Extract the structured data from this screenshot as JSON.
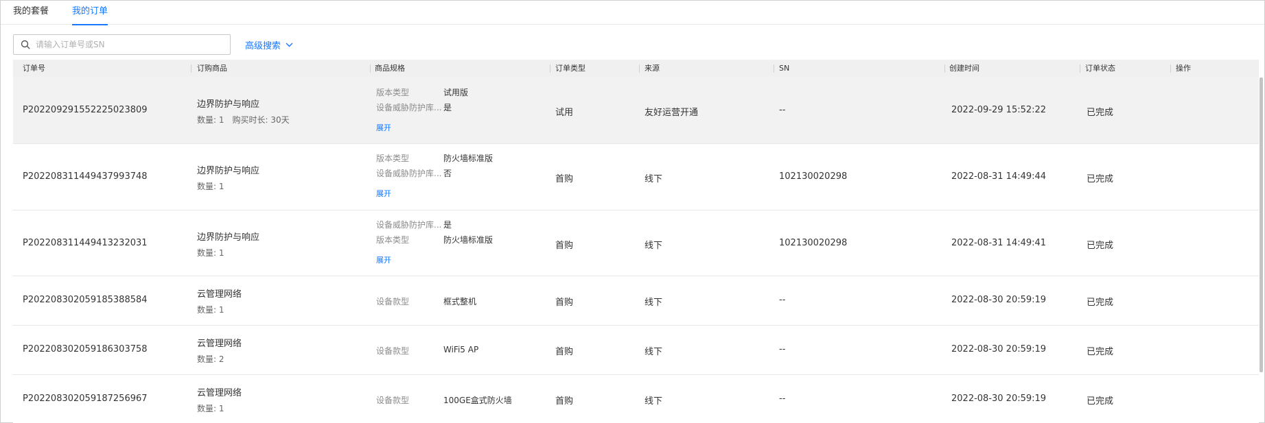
{
  "tabs": [
    {
      "label": "我的套餐"
    },
    {
      "label": "我的订单"
    }
  ],
  "search": {
    "placeholder": "请输入订单号或SN",
    "value": ""
  },
  "advanced_search": {
    "label": "高级搜索"
  },
  "columns": [
    "订单号",
    "订购商品",
    "商品规格",
    "订单类型",
    "来源",
    "SN",
    "创建时间",
    "订单状态",
    "操作"
  ],
  "orders": [
    {
      "order_no": "P20220929155222502380​9",
      "product": "边界防护与响应",
      "qty_text": "数量: 1",
      "duration_text": "购买时长: 30天",
      "specs": [
        {
          "label": "版本类型",
          "value": "试用版"
        },
        {
          "label": "设备威胁防护库...",
          "value": "是"
        }
      ],
      "expand": "展开",
      "type": "试用",
      "source": "友好运营开通",
      "sn": "--",
      "created": "2022-09-29 15:52:22",
      "status": "已完成"
    },
    {
      "order_no": "P20220831144943799374​8",
      "product": "边界防护与响应",
      "qty_text": "数量: 1",
      "specs": [
        {
          "label": "版本类型",
          "value": "防火墙标准版"
        },
        {
          "label": "设备威胁防护库...",
          "value": "否"
        }
      ],
      "expand": "展开",
      "type": "首购",
      "source": "线下",
      "sn": "102130020298",
      "created": "2022-08-31 14:49:44",
      "status": "已完成"
    },
    {
      "order_no": "P20220831144941323203​1",
      "product": "边界防护与响应",
      "qty_text": "数量: 1",
      "specs": [
        {
          "label": "设备威胁防护库...",
          "value": "是"
        },
        {
          "label": "版本类型",
          "value": "防火墙标准版"
        }
      ],
      "expand": "展开",
      "type": "首购",
      "source": "线下",
      "sn": "102130020298",
      "created": "2022-08-31 14:49:41",
      "status": "已完成"
    },
    {
      "order_no": "P20220830205918538858​4",
      "product": "云管理网络",
      "qty_text": "数量: 1",
      "specs": [
        {
          "label": "设备款型",
          "value": "框式整机"
        }
      ],
      "type": "首购",
      "source": "线下",
      "sn": "--",
      "created": "2022-08-30 20:59:19",
      "status": "已完成"
    },
    {
      "order_no": "P20220830205918630375​8",
      "product": "云管理网络",
      "qty_text": "数量: 2",
      "specs": [
        {
          "label": "设备款型",
          "value": "WiFi5 AP"
        }
      ],
      "type": "首购",
      "source": "线下",
      "sn": "--",
      "created": "2022-08-30 20:59:19",
      "status": "已完成"
    },
    {
      "order_no": "P20220830205918725696​7",
      "product": "云管理网络",
      "qty_text": "数量: 1",
      "specs": [
        {
          "label": "设备款型",
          "value": "100GE盒式防火墙"
        }
      ],
      "type": "首购",
      "source": "线下",
      "sn": "--",
      "created": "2022-08-30 20:59:19",
      "status": "已完成"
    }
  ],
  "colors": {
    "accent": "#1677ff",
    "header_bg": "#f0f0f0",
    "row_hover": "#f2f2f2"
  }
}
